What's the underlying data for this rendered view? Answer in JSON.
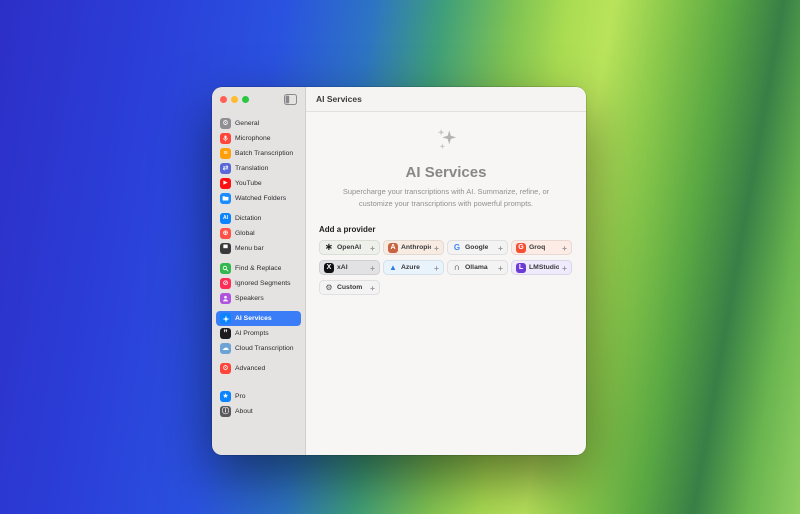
{
  "titlebar": {
    "title": "AI Services"
  },
  "ui": {
    "plus": "+",
    "accent": "#3b7df7"
  },
  "sidebar": {
    "groups": [
      {
        "items": [
          {
            "label": "General",
            "icon": "gear-icon",
            "color": "#8e8e93",
            "glyph": "⚙"
          },
          {
            "label": "Microphone",
            "icon": "microphone-icon",
            "color": "#ff453a",
            "glyph": ""
          },
          {
            "label": "Batch Transcription",
            "icon": "stack-icon",
            "color": "#ff9f0a",
            "glyph": "≡"
          },
          {
            "label": "Translation",
            "icon": "translate-icon",
            "color": "#5868d6",
            "glyph": "⇄"
          },
          {
            "label": "YouTube",
            "icon": "youtube-icon",
            "color": "#ff0f0f",
            "glyph": "▶"
          },
          {
            "label": "Watched Folders",
            "icon": "folder-icon",
            "color": "#1a8cff",
            "glyph": ""
          }
        ]
      },
      {
        "items": [
          {
            "label": "Dictation",
            "icon": "ai-badge-icon",
            "color": "#0a84ff",
            "glyph": "AI"
          },
          {
            "label": "Global",
            "icon": "globe-icon",
            "color": "#ff5147",
            "glyph": "⊕"
          },
          {
            "label": "Menu bar",
            "icon": "menubar-icon",
            "color": "#3a3a3c",
            "glyph": "▀"
          }
        ]
      },
      {
        "items": [
          {
            "label": "Find & Replace",
            "icon": "magnifier-icon",
            "color": "#30b84c",
            "glyph": ""
          },
          {
            "label": "Ignored Segments",
            "icon": "slash-icon",
            "color": "#ff2d55",
            "glyph": "⊘"
          },
          {
            "label": "Speakers",
            "icon": "person-icon",
            "color": "#af52de",
            "glyph": ""
          }
        ]
      },
      {
        "items": [
          {
            "label": "AI Services",
            "icon": "sparkles-icon",
            "color": "#0a84ff",
            "glyph": ""
          },
          {
            "label": "AI Prompts",
            "icon": "prompt-icon",
            "color": "#1c1c1e",
            "glyph": "”"
          },
          {
            "label": "Cloud Transcription",
            "icon": "cloud-icon",
            "color": "#6ba3d6",
            "glyph": "☁"
          }
        ]
      },
      {
        "items": [
          {
            "label": "Advanced",
            "icon": "advanced-gear-icon",
            "color": "#ff453a",
            "glyph": "⚙"
          }
        ]
      },
      {
        "items": [
          {
            "label": "Pro",
            "icon": "pro-star-icon",
            "color": "#0a84ff",
            "glyph": "★"
          },
          {
            "label": "About",
            "icon": "info-icon",
            "color": "#5a5a5e",
            "glyph": "ⓘ"
          }
        ]
      }
    ]
  },
  "main": {
    "title": "AI Services",
    "description": "Supercharge your transcriptions with AI. Summarize, refine, or customize your transcriptions with powerful prompts.",
    "add_provider_label": "Add a provider"
  },
  "providers": [
    {
      "name": "OpenAI",
      "icon": "openai-logo-icon",
      "tint": "#eef0ea",
      "glyph": "∗",
      "icon_color": "#1f1f1f"
    },
    {
      "name": "Anthropic",
      "icon": "anthropic-logo-icon",
      "tint": "#f8ece2",
      "glyph": "A",
      "icon_bg": "#c96442",
      "icon_color": "#ffffff"
    },
    {
      "name": "Google",
      "icon": "google-logo-icon",
      "tint": "#f3f3f4",
      "glyph": "G",
      "icon_color": "#4285f4"
    },
    {
      "name": "Groq",
      "icon": "groq-logo-icon",
      "tint": "#fdebe5",
      "glyph": "G",
      "icon_bg": "#f55036",
      "icon_color": "#ffffff"
    },
    {
      "name": "xAI",
      "icon": "xai-logo-icon",
      "tint": "#e2e2e4",
      "glyph": "X",
      "icon_bg": "#111111",
      "icon_color": "#ffffff"
    },
    {
      "name": "Azure",
      "icon": "azure-logo-icon",
      "tint": "#e9f3fc",
      "glyph": "▲",
      "icon_color": "#2f7de1"
    },
    {
      "name": "Ollama",
      "icon": "ollama-logo-icon",
      "tint": "#f3f3f4",
      "glyph": "∩",
      "icon_color": "#222222"
    },
    {
      "name": "LMStudio",
      "icon": "lmstudio-logo-icon",
      "tint": "#efeafc",
      "glyph": "L",
      "icon_bg": "#6e3ad6",
      "icon_color": "#ffffff"
    },
    {
      "name": "Custom",
      "icon": "custom-gear-icon",
      "tint": "#f3f3f4",
      "glyph": "⚙",
      "icon_color": "#555555"
    }
  ]
}
